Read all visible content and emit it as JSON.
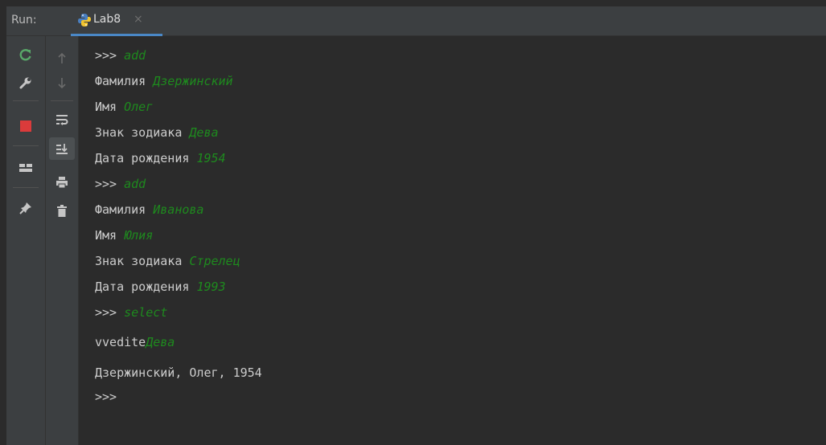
{
  "tabbar": {
    "run_label": "Run:",
    "tab": {
      "label": "Lab8",
      "close": "×",
      "icon": "python-icon"
    }
  },
  "toolbar_left": [
    "rerun-icon",
    "wrench-icon",
    "stop-icon",
    "layout-icon",
    "pin-icon"
  ],
  "toolbar_right": [
    "arrow-up-icon",
    "arrow-down-icon",
    "soft-wrap-icon",
    "scroll-to-end-icon",
    "print-icon",
    "trash-icon"
  ],
  "colors": {
    "background": "#2b2b2b",
    "panel": "#3c3f41",
    "output_text": "#cccccc",
    "user_input": "#1e8a1e",
    "tab_accent": "#4a88c7"
  },
  "console": {
    "lines": [
      {
        "text": ">>> ",
        "input": "add"
      },
      {
        "text": "Фамилия ",
        "input": "Дзержинский"
      },
      {
        "text": "Имя ",
        "input": "Олег"
      },
      {
        "text": "Знак зодиака ",
        "input": "Дева"
      },
      {
        "text": "Дата рождения ",
        "input": "1954"
      },
      {
        "text": ">>> ",
        "input": "add"
      },
      {
        "text": "Фамилия ",
        "input": "Иванова"
      },
      {
        "text": "Имя ",
        "input": "Юлия"
      },
      {
        "text": "Знак зодиака ",
        "input": "Стрелец"
      },
      {
        "text": "Дата рождения ",
        "input": "1993"
      },
      {
        "text": ">>> ",
        "input": "select"
      },
      {
        "text": "vvedite",
        "input": "Дева"
      },
      {
        "text": "Дзержинский, Олег, 1954",
        "input": ""
      },
      {
        "text": ">>>",
        "input": ""
      }
    ]
  }
}
